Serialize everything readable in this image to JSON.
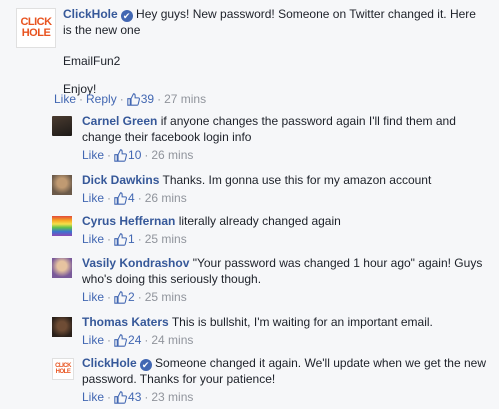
{
  "main_post": {
    "logo_line1": "CLICK",
    "logo_line2": "HOLE",
    "author": "ClickHole",
    "verified_mark": "✔",
    "text_line1": "Hey guys! New password! Someone on Twitter changed it. Here",
    "text_line2": "is the new one",
    "password": "EmailFun2",
    "sign_off": "Enjoy!",
    "like_label": "Like",
    "reply_label": "Reply",
    "likes": "39",
    "time": "27 mins"
  },
  "replies": [
    {
      "author": "Carnel Green",
      "text": "if anyone changes the password again I'll find them and change their facebook login info",
      "like_label": "Like",
      "likes": "10",
      "time": "26 mins"
    },
    {
      "author": "Dick Dawkins",
      "text": "Thanks. Im gonna use this for my amazon account",
      "like_label": "Like",
      "likes": "4",
      "time": "26 mins"
    },
    {
      "author": "Cyrus Heffernan",
      "text": "literally already changed again",
      "like_label": "Like",
      "likes": "1",
      "time": "25 mins"
    },
    {
      "author": "Vasily Kondrashov",
      "text": "\"Your password was changed 1 hour ago\" again! Guys who's doing this seriously though.",
      "like_label": "Like",
      "likes": "2",
      "time": "25 mins"
    },
    {
      "author": "Thomas Katers",
      "text": "This is bullshit, I'm waiting for an important email.",
      "like_label": "Like",
      "likes": "24",
      "time": "24 mins"
    },
    {
      "author": "ClickHole",
      "logo_line1": "CLICK",
      "logo_line2": "HOLE",
      "verified_mark": "✔",
      "text": "Someone changed it again. We'll update when we get the new password. Thanks for your patience!",
      "like_label": "Like",
      "likes": "43",
      "time": "23 mins"
    }
  ],
  "separator": "·",
  "colors": {
    "name_link": "#365899",
    "action_link": "#4267b2",
    "meta_gray": "#90949c",
    "background": "#f6f7f9",
    "brand_orange": "#e8531f"
  }
}
